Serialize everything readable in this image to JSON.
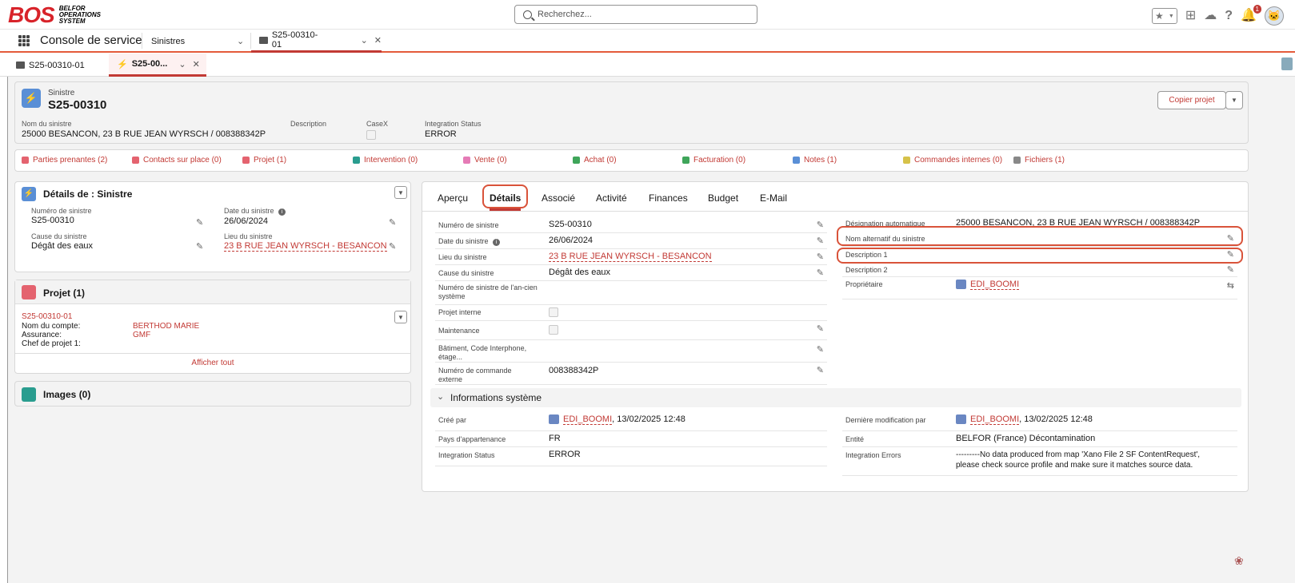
{
  "app": {
    "logo_main": "BOS",
    "logo_sub": [
      "BELFOR",
      "OPERATIONS",
      "SYSTEM"
    ],
    "search_placeholder": "Recherchez...",
    "notification_count": "1",
    "console_name": "Console de service"
  },
  "nav_tabs": [
    {
      "label": "Sinistres"
    },
    {
      "label": "S25-00310-01"
    }
  ],
  "sub_tabs": [
    {
      "label": "S25-00310-01"
    },
    {
      "label": "S25-00..."
    }
  ],
  "header": {
    "object": "Sinistre",
    "name": "S25-00310",
    "copy_button": "Copier projet",
    "fields": [
      {
        "label": "Nom du sinistre",
        "value": "25000 BESANCON, 23 B RUE JEAN WYRSCH / 008388342P"
      },
      {
        "label": "Description",
        "value": ""
      },
      {
        "label": "CaseX",
        "value": ""
      },
      {
        "label": "Integration Status",
        "value": "ERROR"
      }
    ]
  },
  "related": [
    {
      "label": "Parties prenantes (2)",
      "color": "#e4636f"
    },
    {
      "label": "Contacts sur place (0)",
      "color": "#e4636f"
    },
    {
      "label": "Projet (1)",
      "color": "#e4636f"
    },
    {
      "label": "Intervention (0)",
      "color": "#2a9d8f"
    },
    {
      "label": "Vente (0)",
      "color": "#e57bb6"
    },
    {
      "label": "Achat (0)",
      "color": "#3fa55a"
    },
    {
      "label": "Facturation (0)",
      "color": "#3fa55a"
    },
    {
      "label": "Notes (1)",
      "color": "#5a8fd6"
    },
    {
      "label": "Commandes internes (0)",
      "color": "#d6c24a"
    },
    {
      "label": "Fichiers (1)",
      "color": "#888888"
    }
  ],
  "details_card": {
    "title": "Détails de : Sinistre",
    "f1_label": "Numéro de sinistre",
    "f1_value": "S25-00310",
    "f2_label": "Date du sinistre",
    "f2_value": "26/06/2024",
    "f3_label": "Cause du sinistre",
    "f3_value": "Dégât des eaux",
    "f4_label": "Lieu du sinistre",
    "f4_value": "23 B RUE JEAN WYRSCH - BESANCON"
  },
  "projet_card": {
    "title": "Projet (1)",
    "item": "S25-00310-01",
    "rows": [
      {
        "label": "Nom du compte:",
        "value": "BERTHOD MARIE"
      },
      {
        "label": "Assurance:",
        "value": "GMF"
      },
      {
        "label": "Chef de projet 1:",
        "value": ""
      }
    ],
    "view_all": "Afficher tout"
  },
  "images_card": {
    "title": "Images (0)"
  },
  "tabs": [
    "Aperçu",
    "Détails",
    "Associé",
    "Activité",
    "Finances",
    "Budget",
    "E-Mail"
  ],
  "left_fields": [
    {
      "label": "Numéro de sinistre",
      "value": "S25-00310"
    },
    {
      "label": "Date du sinistre",
      "value": "26/06/2024"
    },
    {
      "label": "Lieu du sinistre",
      "value": "23 B RUE JEAN WYRSCH - BESANCON"
    },
    {
      "label": "Cause du sinistre",
      "value": "Dégât des eaux"
    },
    {
      "label": "Numéro de sinistre de l'an-cien système",
      "value": ""
    },
    {
      "label": "Projet interne",
      "value": ""
    },
    {
      "label": "Maintenance",
      "value": ""
    },
    {
      "label": "Bâtiment, Code Interphone, étage...",
      "value": ""
    },
    {
      "label": "Numéro de commande externe",
      "value": "008388342P"
    }
  ],
  "right_fields": [
    {
      "label": "Désignation automatique",
      "value": "25000 BESANCON, 23 B RUE JEAN WYRSCH / 008388342P"
    },
    {
      "label": "Nom alternatif du sinistre",
      "value": ""
    },
    {
      "label": "Description 1",
      "value": ""
    },
    {
      "label": "Description 2",
      "value": ""
    },
    {
      "label": "Propriétaire",
      "value": "EDI_BOOMI"
    }
  ],
  "system_section": {
    "title": "Informations système",
    "created_label": "Créé par",
    "created_user": "EDI_BOOMI",
    "created_date": ", 13/02/2025 12:48",
    "modified_label": "Dernière modification par",
    "modified_user": "EDI_BOOMI",
    "modified_date": ", 13/02/2025 12:48",
    "country_label": "Pays d'appartenance",
    "country_value": "FR",
    "entity_label": "Entité",
    "entity_value": "BELFOR (France) Décontamination",
    "istatus_label": "Integration Status",
    "istatus_value": "ERROR",
    "ierrors_label": "Integration Errors",
    "ierrors_line1": "---------No data produced from map 'Xano File 2 SF ContentRequest',",
    "ierrors_line2": "please check source profile and make sure it matches source data."
  }
}
